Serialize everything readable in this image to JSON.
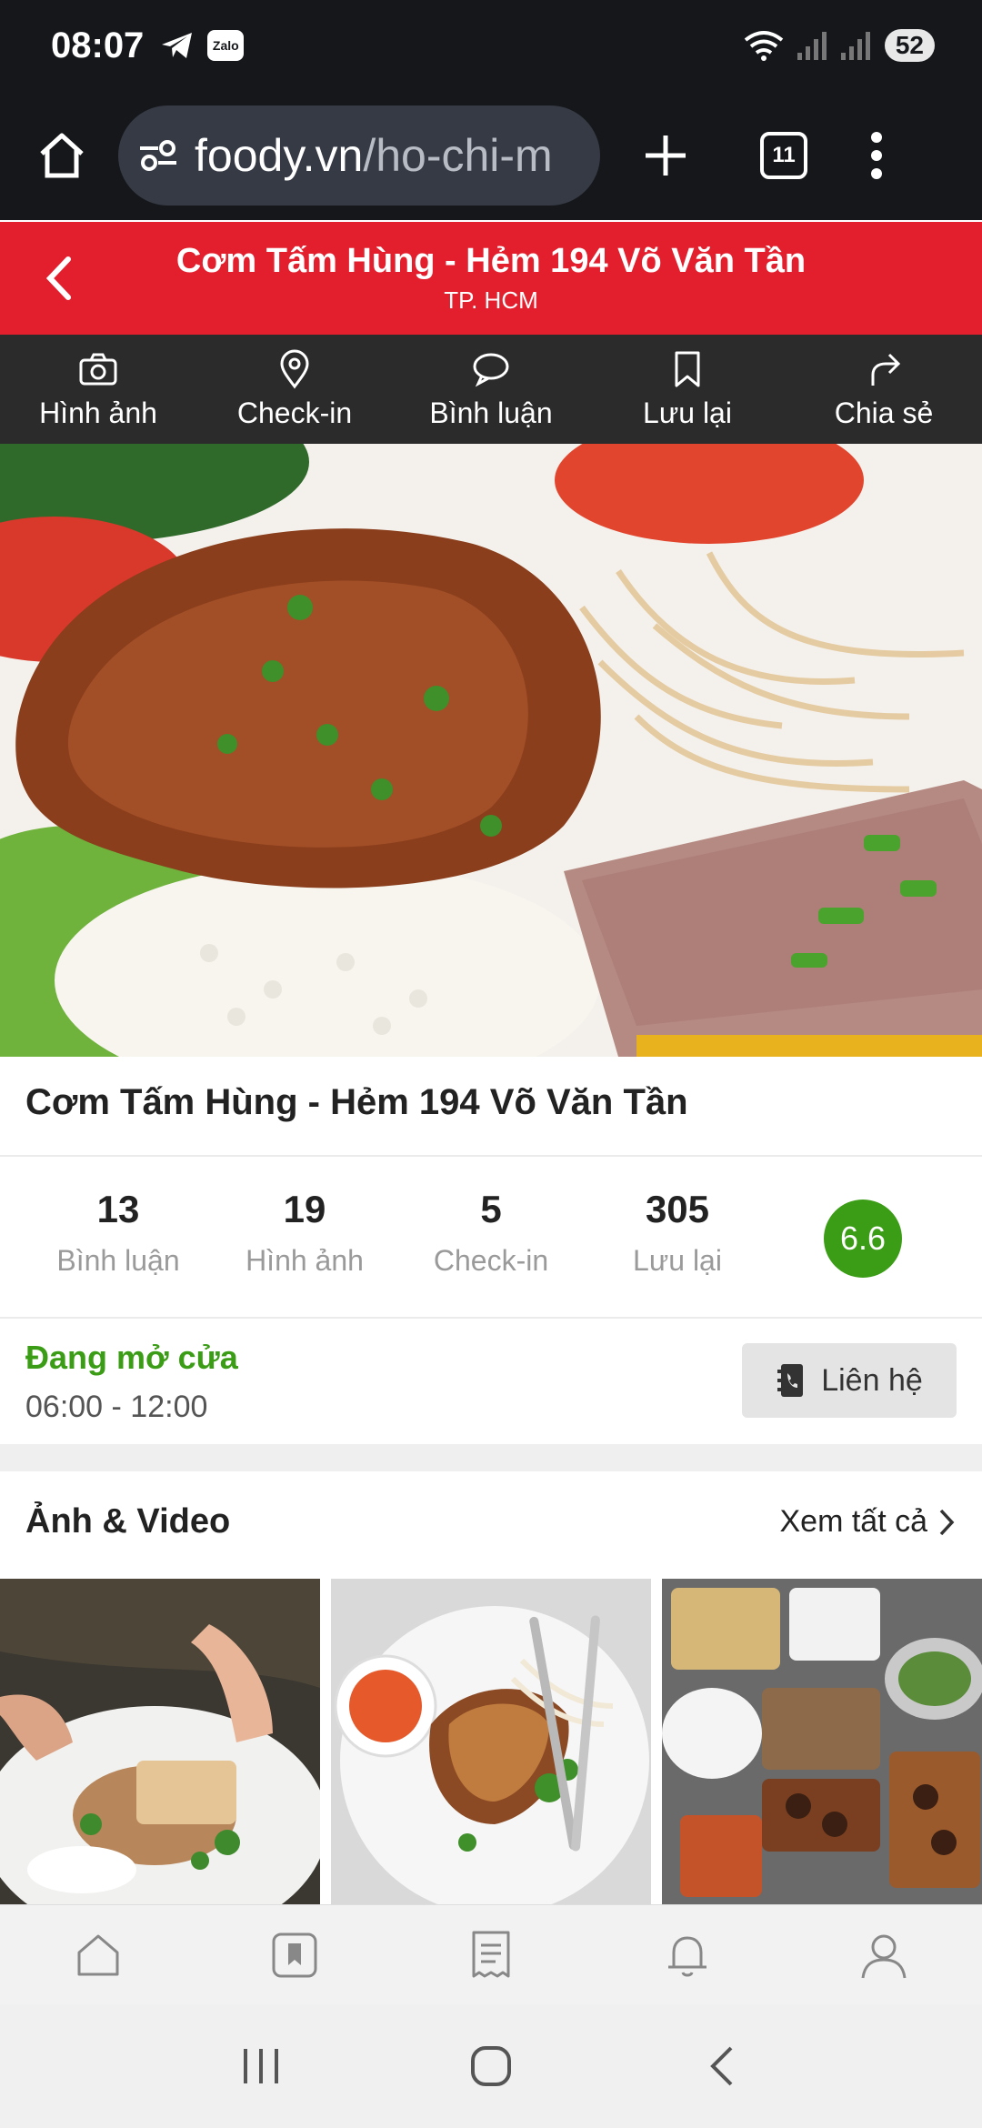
{
  "status_bar": {
    "time": "08:07",
    "battery": "52",
    "zalo_label": "Zalo"
  },
  "browser": {
    "url_main": "foody.vn",
    "url_rest": "/ho-chi-m",
    "tab_count": "11"
  },
  "header": {
    "title": "Cơm Tấm Hùng - Hẻm 194 Võ Văn Tần",
    "subtitle": "TP. HCM"
  },
  "actions": [
    {
      "label": "Hình ảnh",
      "icon": "camera-icon"
    },
    {
      "label": "Check-in",
      "icon": "location-pin-icon"
    },
    {
      "label": "Bình luận",
      "icon": "comment-icon"
    },
    {
      "label": "Lưu lại",
      "icon": "bookmark-icon"
    },
    {
      "label": "Chia sẻ",
      "icon": "share-icon"
    }
  ],
  "restaurant": {
    "name": "Cơm Tấm Hùng - Hẻm 194 Võ Văn Tần"
  },
  "stats": [
    {
      "value": "13",
      "label": "Bình luận"
    },
    {
      "value": "19",
      "label": "Hình ảnh"
    },
    {
      "value": "5",
      "label": "Check-in"
    },
    {
      "value": "305",
      "label": "Lưu lại"
    }
  ],
  "score": "6.6",
  "open": {
    "status": "Đang mở cửa",
    "hours": "06:00 - 12:00",
    "contact_label": "Liên hệ"
  },
  "media": {
    "title": "Ảnh & Video",
    "see_all": "Xem tất cả"
  },
  "colors": {
    "brand_red": "#e31e2d",
    "open_green": "#3b9c16",
    "dark_bar": "#15171b"
  },
  "bottom_nav": [
    "home-icon",
    "bookmark-icon",
    "list-icon",
    "bell-icon",
    "user-icon"
  ]
}
